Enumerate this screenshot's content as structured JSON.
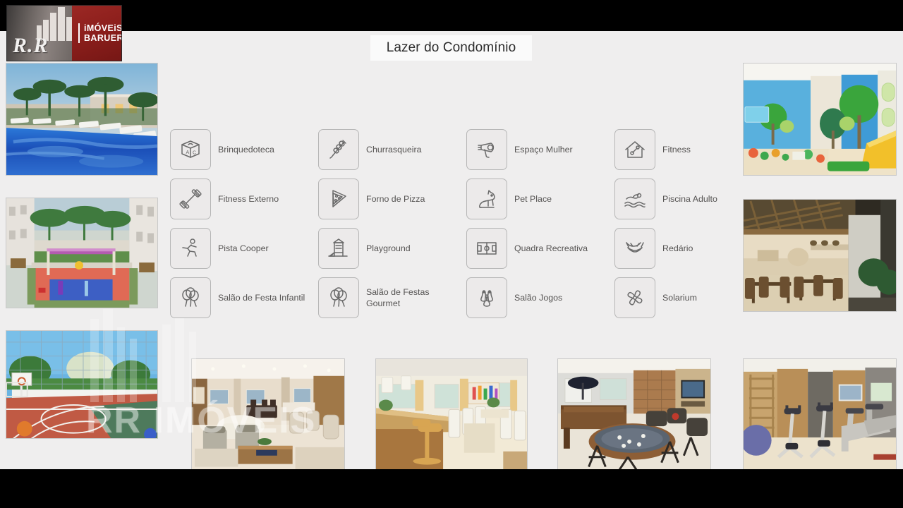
{
  "brand": {
    "logo_primary": "R.R",
    "logo_secondary_line1": "iMÓVEiS",
    "logo_secondary_line2": "BARUERI",
    "logo_gray": "#6d6663",
    "logo_red": "#8d1f1c"
  },
  "slide": {
    "title": "Lazer do Condomínio",
    "background": "#efeeee",
    "letterbox_color": "#000000"
  },
  "watermark": {
    "text": "RR IMÓVEIS"
  },
  "amenities": [
    {
      "label": "Brinquedoteca",
      "icon": "toy-block-icon",
      "col": 0,
      "row": 0
    },
    {
      "label": "Fitness Externo",
      "icon": "dumbbell-icon",
      "col": 0,
      "row": 1
    },
    {
      "label": "Pista Cooper",
      "icon": "runner-icon",
      "col": 0,
      "row": 2
    },
    {
      "label": "Salão de Festa Infantil",
      "icon": "balloons-icon",
      "col": 0,
      "row": 3
    },
    {
      "label": "Churrasqueira",
      "icon": "skewer-icon",
      "col": 1,
      "row": 0
    },
    {
      "label": "Forno de Pizza",
      "icon": "pizza-slice-icon",
      "col": 1,
      "row": 1
    },
    {
      "label": "Playground",
      "icon": "slide-tower-icon",
      "col": 1,
      "row": 2
    },
    {
      "label": "Salão de Festas Gourmet",
      "icon": "balloons-icon",
      "col": 1,
      "row": 3
    },
    {
      "label": "Espaço Mulher",
      "icon": "hair-dryer-icon",
      "col": 2,
      "row": 0
    },
    {
      "label": "Pet Place",
      "icon": "dog-icon",
      "col": 2,
      "row": 1
    },
    {
      "label": "Quadra Recreativa",
      "icon": "sports-field-icon",
      "col": 2,
      "row": 2
    },
    {
      "label": "Salão Jogos",
      "icon": "bowling-pins-icon",
      "col": 2,
      "row": 3
    },
    {
      "label": "Fitness",
      "icon": "gym-house-icon",
      "col": 3,
      "row": 0
    },
    {
      "label": "Piscina Adulto",
      "icon": "swimmer-icon",
      "col": 3,
      "row": 1
    },
    {
      "label": "Redário",
      "icon": "hammock-icon",
      "col": 3,
      "row": 2
    },
    {
      "label": "Solarium",
      "icon": "pinwheel-icon",
      "col": 3,
      "row": 3
    }
  ],
  "photos": [
    {
      "name": "photo-pool",
      "caption": "Piscina com espreguiçadeiras e palmeiras ao entardecer"
    },
    {
      "name": "photo-playground",
      "caption": "Playground com piso vermelho e azul entre os blocos"
    },
    {
      "name": "photo-kids-room",
      "caption": "Brinquedoteca com mural de árvores e escorregador"
    },
    {
      "name": "photo-bbq-area",
      "caption": "Churrasqueira com pergolado e mesas de madeira"
    },
    {
      "name": "photo-sports-court",
      "caption": "Quadra recreativa com cesta de basquete e alambrado"
    },
    {
      "name": "photo-lounge",
      "caption": "Salão de festas com poltronas e mesa de centro"
    },
    {
      "name": "photo-gourmet",
      "caption": "Salão de festas gourmet com bancada e banquetas"
    },
    {
      "name": "photo-games-room",
      "caption": "Salão de jogos com mesa de sinuca e mesa redonda"
    },
    {
      "name": "photo-gym",
      "caption": "Fitness com bicicletas ergométricas e esteiras"
    }
  ]
}
